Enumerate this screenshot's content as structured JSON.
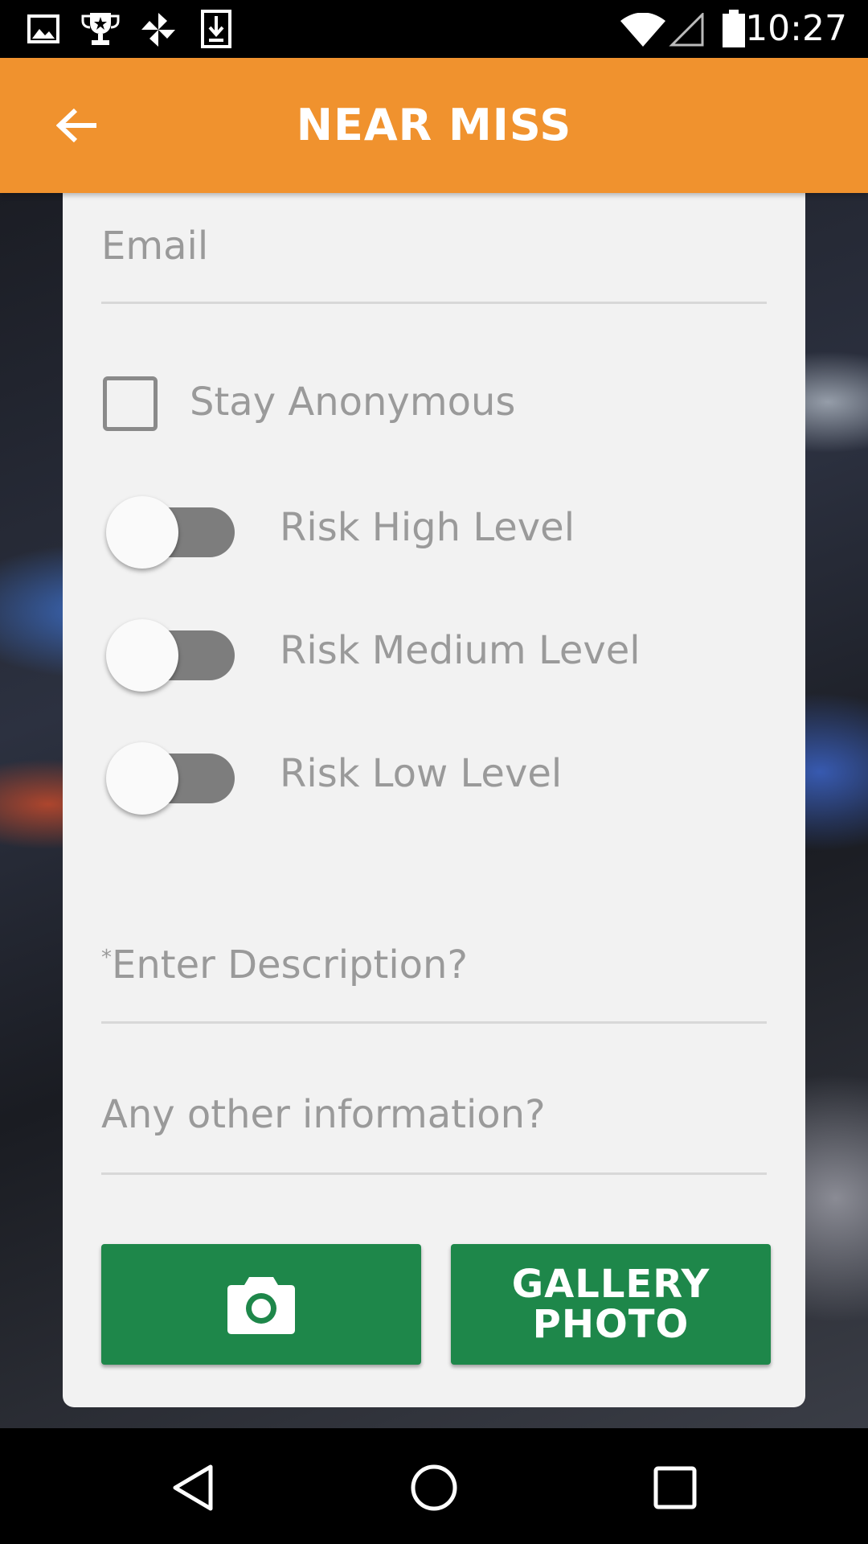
{
  "status_bar": {
    "time": "10:27",
    "left_icons": [
      "image-icon",
      "trophy-icon",
      "pinwheel-icon",
      "download-icon"
    ],
    "right_icons": [
      "wifi-icon",
      "cell-signal-icon",
      "battery-icon"
    ]
  },
  "app_bar": {
    "title": "NEAR MISS",
    "back_icon": "arrow-left-icon",
    "background_color": "#f0922e"
  },
  "form": {
    "email_placeholder": "Email",
    "stay_anonymous_label": "Stay Anonymous",
    "toggles": [
      {
        "label": "Risk High Level",
        "on": false
      },
      {
        "label": "Risk Medium Level",
        "on": false
      },
      {
        "label": "Risk Low Level",
        "on": false
      }
    ],
    "description_required_marker": "*",
    "description_placeholder": "Enter Description?",
    "other_info_placeholder": "Any other information?",
    "camera_button_icon": "camera-icon",
    "gallery_button_line1": "GALLERY",
    "gallery_button_line2": "PHOTO",
    "button_color": "#1e874a"
  },
  "nav_bar": {
    "icons": [
      "back-triangle-icon",
      "home-circle-icon",
      "recents-square-icon"
    ]
  }
}
